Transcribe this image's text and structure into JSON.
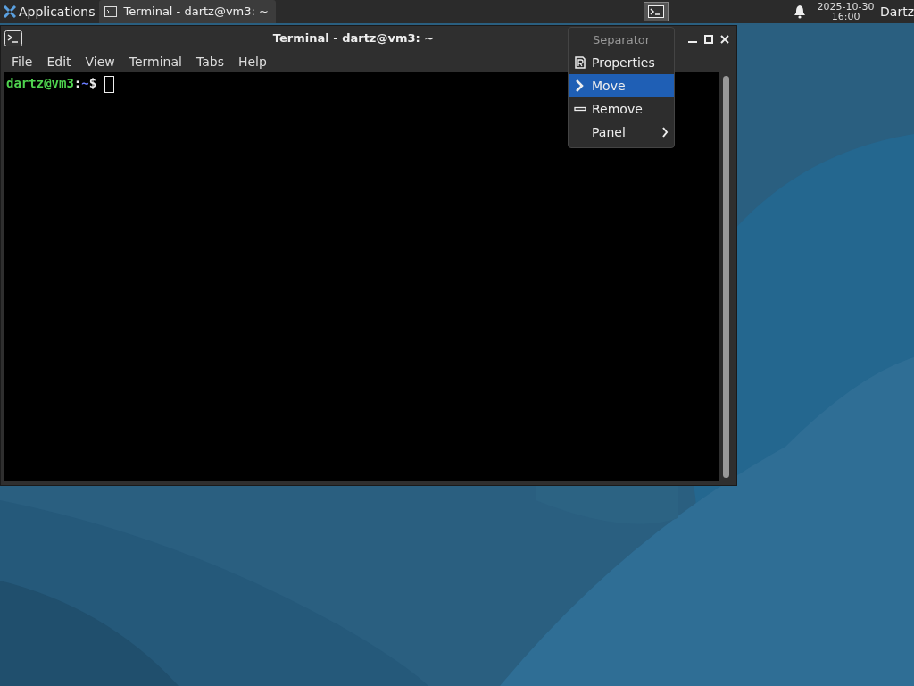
{
  "panel": {
    "applications": "Applications",
    "tasks": [
      {
        "title": "Terminal - dartz@vm3: ~",
        "selected": true
      }
    ],
    "clock_date": "2025-10-30",
    "clock_time": "16:00",
    "user": "Dartz"
  },
  "window": {
    "title": "Terminal - dartz@vm3: ~",
    "menu": [
      "File",
      "Edit",
      "View",
      "Terminal",
      "Tabs",
      "Help"
    ],
    "prompt": {
      "user_host": "dartz@vm3",
      "separator": ":",
      "path": "~",
      "symbol": "$"
    }
  },
  "context_menu": {
    "header": "Separator",
    "items": [
      {
        "label": "Properties",
        "kind": "properties",
        "selected": false,
        "submenu": false
      },
      {
        "label": "Move",
        "kind": "move",
        "selected": true,
        "submenu": false
      },
      {
        "label": "Remove",
        "kind": "remove",
        "selected": false,
        "submenu": false
      },
      {
        "label": "Panel",
        "kind": "none",
        "selected": false,
        "submenu": true
      }
    ]
  }
}
